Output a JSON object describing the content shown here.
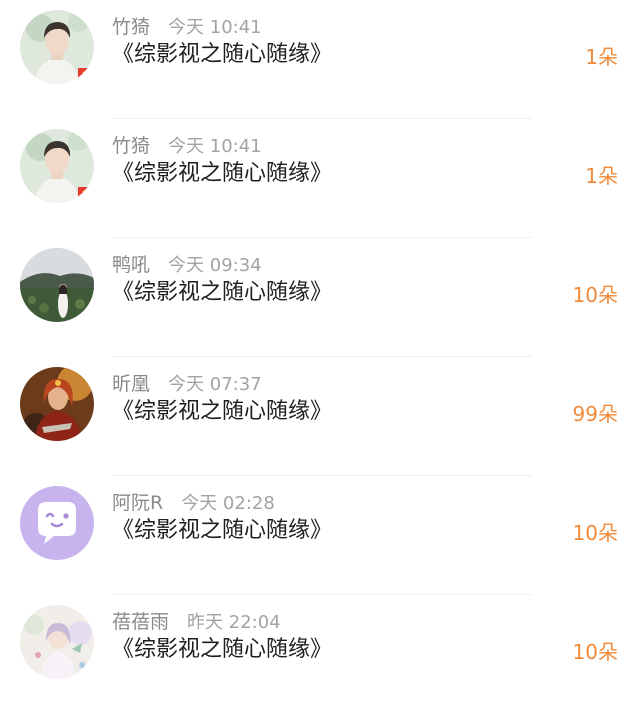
{
  "colors": {
    "name": "#8a8a8a",
    "time": "#a3a3a3",
    "title": "#1f1f1f",
    "gift_count": "#f08a3a",
    "divider": "#f0f0f0"
  },
  "rows": [
    {
      "avatar": "portrait-avatar-icon",
      "name": "竹猗",
      "time": "今天 10:41",
      "title": "《综影视之随心随缘》",
      "gift": "1朵"
    },
    {
      "avatar": "portrait-avatar-icon",
      "name": "竹猗",
      "time": "今天 10:41",
      "title": "《综影视之随心随缘》",
      "gift": "1朵"
    },
    {
      "avatar": "landscape-avatar-icon",
      "name": "鸭吼",
      "time": "今天 09:34",
      "title": "《综影视之随心随缘》",
      "gift": "10朵"
    },
    {
      "avatar": "warrior-avatar-icon",
      "name": "昕凰",
      "time": "今天 07:37",
      "title": "《综影视之随心随缘》",
      "gift": "99朵"
    },
    {
      "avatar": "chat-bubble-avatar-icon",
      "name": "阿阮R",
      "time": "今天 02:28",
      "title": "《综影视之随心随缘》",
      "gift": "10朵"
    },
    {
      "avatar": "illustration-avatar-icon",
      "name": "蓓蓓雨",
      "time": "昨天 22:04",
      "title": "《综影视之随心随缘》",
      "gift": "10朵"
    }
  ]
}
